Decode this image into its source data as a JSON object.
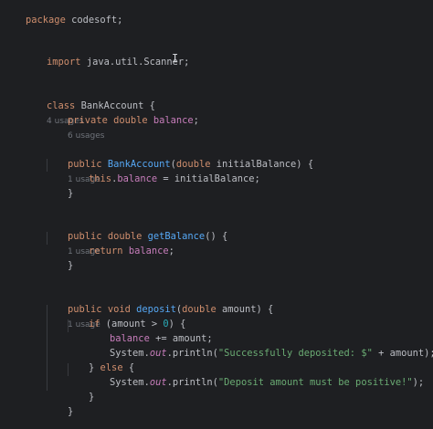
{
  "code": {
    "l1": {
      "kw": "package",
      "rest": " codesoft;"
    },
    "l2": {
      "kw": "import",
      "rest": " java.util.Scanner;"
    },
    "l3": {
      "kw": "class",
      "name": " BankAccount {",
      "hint": "4 usages"
    },
    "l4": {
      "kw": "private double",
      "field": " balance",
      "semi": ";",
      "hint": "6 usages"
    },
    "l5": {
      "kw": "public",
      "fn": " BankAccount",
      "p1": "(",
      "kw2": "double",
      "p2": " initialBalance) {",
      "hint": "1 usage"
    },
    "l6": {
      "kw": "this",
      "dot": ".",
      "field": "balance",
      "rest": " = initialBalance;"
    },
    "l7": {
      "brace": "}"
    },
    "l8": {
      "kw": "public double",
      "fn": " getBalance",
      "rest": "() {",
      "hint": "1 usage"
    },
    "l9": {
      "kw": "return",
      "field": " balance",
      "semi": ";"
    },
    "l10": {
      "brace": "}"
    },
    "l11": {
      "kw": "public void",
      "fn": " deposit",
      "p1": "(",
      "kw2": "double",
      "p2": " amount) {",
      "hint": "1 usage"
    },
    "l12": {
      "kw": "if",
      "p1": " (amount > ",
      "num": "0",
      "p2": ") {"
    },
    "l13": {
      "field": "balance",
      "rest": " += amount;"
    },
    "l14": {
      "sys": "System.",
      "out": "out",
      "p1": ".println(",
      "str": "\"Successfully deposited: $\"",
      "p2": " + amount);"
    },
    "l15": {
      "p1": "} ",
      "kw": "else",
      "p2": " {"
    },
    "l16": {
      "sys": "System.",
      "out": "out",
      "p1": ".println(",
      "str": "\"Deposit amount must be positive!\"",
      "p2": ");"
    },
    "l17": {
      "brace": "}"
    },
    "l18": {
      "brace": "}"
    }
  },
  "cursor_glyph": "I",
  "colors": {
    "background": "#1e1f22",
    "keyword": "#cf8e6d",
    "function": "#56a8f5",
    "field": "#c77dbb",
    "string": "#6aab73",
    "number": "#2aacb8",
    "text": "#bcbec4",
    "hint": "#6f737a"
  }
}
